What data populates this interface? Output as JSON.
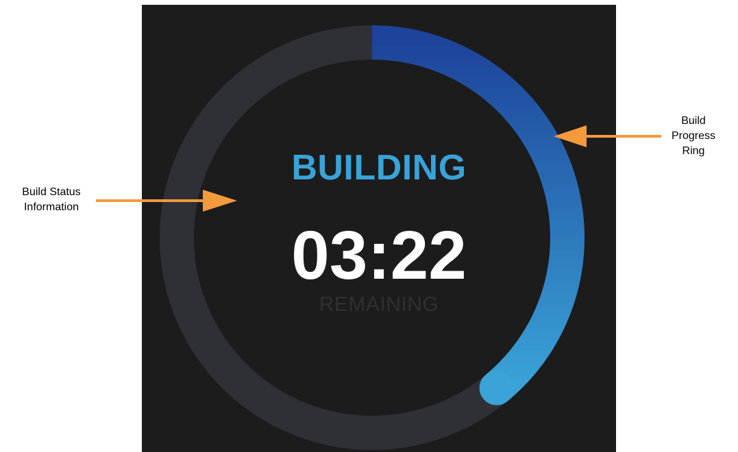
{
  "build": {
    "status": "BUILDING",
    "time_remaining": "03:22",
    "remaining_label": "REMAINING",
    "progress_fraction": 0.39
  },
  "annotations": {
    "left_callout": "Build Status\nInformation",
    "right_callout": "Build\nProgress\nRing"
  },
  "colors": {
    "screen_background": "#1c1c1d",
    "ring_track": "#2f3035",
    "ring_start": "#1d449a",
    "ring_end": "#3aa3d8",
    "status_color": "#3aa3d8",
    "time_color": "#ffffff",
    "remaining_color": "#2f3035",
    "arrow_color": "#f39a3d"
  }
}
